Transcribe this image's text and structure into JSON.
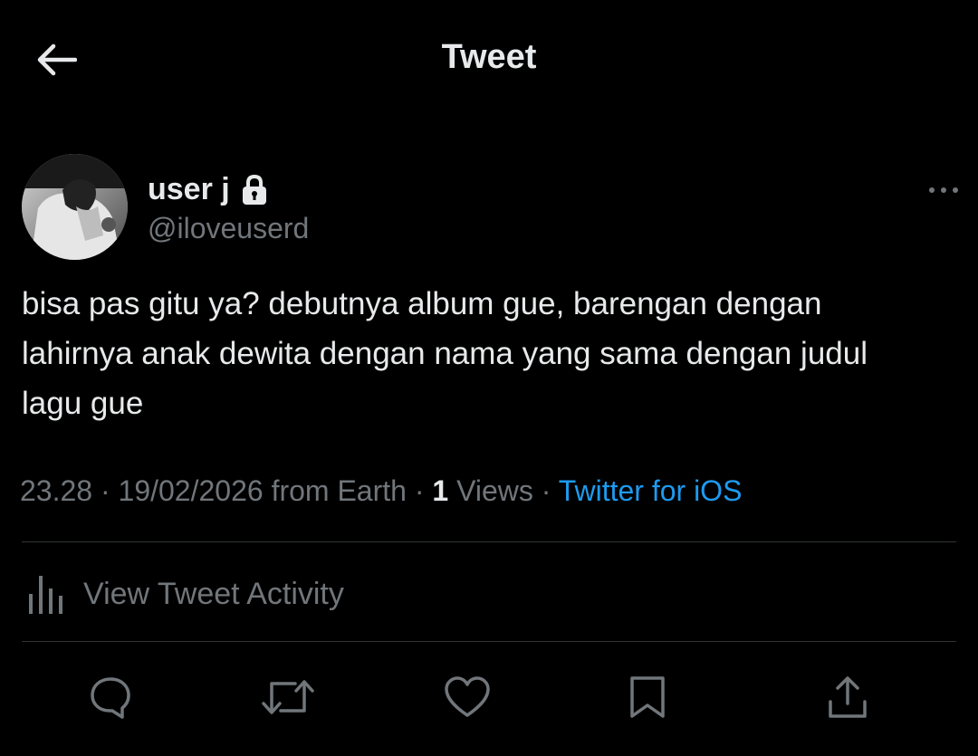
{
  "header": {
    "title": "Tweet",
    "back_icon": "arrow-left-icon"
  },
  "author": {
    "display_name": "user j",
    "handle": "@iloveuserd",
    "protected_icon": "lock-icon",
    "more_icon": "more-horizontal-icon"
  },
  "tweet": {
    "text": "bisa pas gitu ya? debutnya album gue, barengan dengan\nlahirnya anak dewita dengan nama yang sama dengan judul\nlagu gue"
  },
  "meta": {
    "time": "23.28",
    "separator": " · ",
    "date": "19/02/2026",
    "location": "from Earth",
    "views_count": "1",
    "views_label": "Views",
    "source": "Twitter for iOS"
  },
  "activity": {
    "label": "View Tweet Activity",
    "icon": "analytics-icon"
  },
  "actions": [
    {
      "name": "reply",
      "icon": "reply-icon"
    },
    {
      "name": "retweet",
      "icon": "retweet-icon"
    },
    {
      "name": "like",
      "icon": "heart-icon"
    },
    {
      "name": "bookmark",
      "icon": "bookmark-icon"
    },
    {
      "name": "share",
      "icon": "share-icon"
    }
  ],
  "colors": {
    "background": "#000000",
    "text_primary": "#e7e9ea",
    "text_secondary": "#71767b",
    "link": "#1d9bf0",
    "divider": "#2f3336"
  }
}
